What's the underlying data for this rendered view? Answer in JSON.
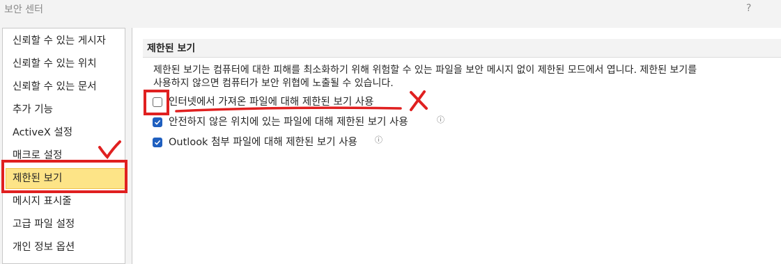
{
  "window": {
    "title": "보안 센터",
    "help_label": "?"
  },
  "sidebar": {
    "items": [
      {
        "label": "신뢰할 수 있는 게시자"
      },
      {
        "label": "신뢰할 수 있는 위치"
      },
      {
        "label": "신뢰할 수 있는 문서"
      },
      {
        "label": "추가 기능"
      },
      {
        "label": "ActiveX 설정"
      },
      {
        "label": "매크로 설정"
      },
      {
        "label": "제한된 보기",
        "selected": true
      },
      {
        "label": "메시지 표시줄"
      },
      {
        "label": "고급 파일 설정"
      },
      {
        "label": "개인 정보 옵션"
      }
    ]
  },
  "main": {
    "section_title": "제한된 보기",
    "description": "제한된 보기는 컴퓨터에 대한 피해를 최소화하기 위해 위험할 수 있는 파일을 보안 메시지 없이 제한된 모드에서 엽니다. 제한된 보기를\n사용하지 않으면 컴퓨터가 보안 위협에 노출될 수 있습니다.",
    "options": [
      {
        "label": "인터넷에서 가져온 파일에 대해 제한된 보기 사용",
        "checked": false,
        "info": false
      },
      {
        "label": "안전하지 않은 위치에 있는 파일에 대해 제한된 보기 사용",
        "checked": true,
        "info": true
      },
      {
        "label": "Outlook 첨부 파일에 대해 제한된 보기 사용",
        "checked": true,
        "info": true
      }
    ],
    "info_glyph": "ⓘ"
  },
  "colors": {
    "accent": "#1f5fbf",
    "selection": "#fde487",
    "annotation": "#e02020"
  }
}
